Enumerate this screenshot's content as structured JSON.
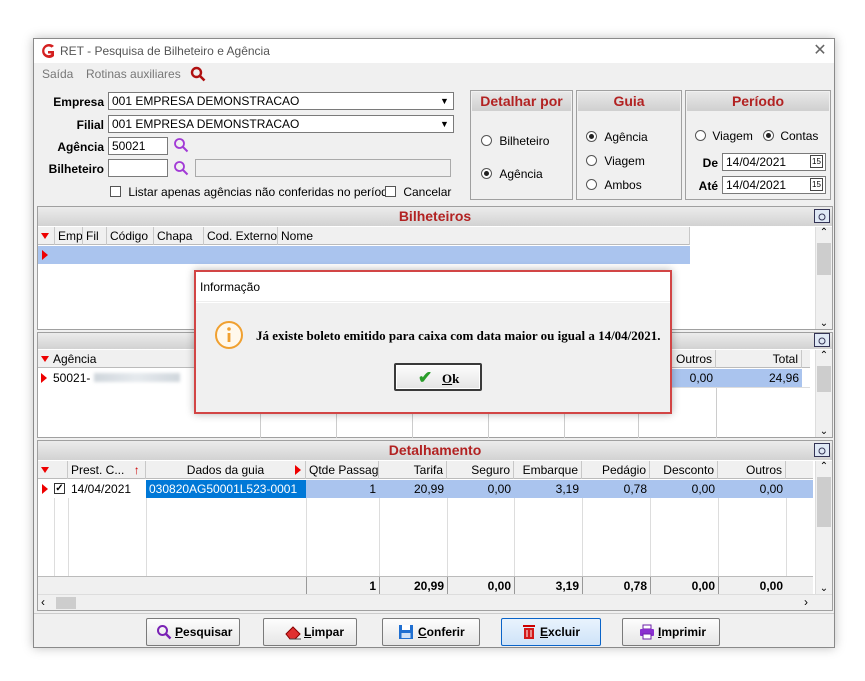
{
  "window": {
    "title": "RET - Pesquisa de Bilheteiro e Agência"
  },
  "menu": {
    "items": [
      "Saída",
      "Rotinas auxiliares"
    ]
  },
  "filters": {
    "empresa_label": "Empresa",
    "empresa_value": "001 EMPRESA DEMONSTRACAO",
    "filial_label": "Filial",
    "filial_value": "001 EMPRESA DEMONSTRACAO",
    "agencia_label": "Agência",
    "agencia_value": "50021",
    "bilheteiro_label": "Bilheteiro",
    "bilheteiro_value": "",
    "bilheteiro_name": "",
    "listar_label": "Listar apenas agências não conferidas no período",
    "cancelar_label": "Cancelar"
  },
  "detalhar": {
    "title": "Detalhar por",
    "options": [
      "Bilheteiro",
      "Agência"
    ],
    "selected": "Agência"
  },
  "guia": {
    "title": "Guia",
    "options": [
      "Agência",
      "Viagem",
      "Ambos"
    ],
    "selected": "Agência"
  },
  "periodo": {
    "title": "Período",
    "options": [
      "Viagem",
      "Contas"
    ],
    "selected": "Contas",
    "de_label": "De",
    "de_value": "14/04/2021",
    "ate_label": "Até",
    "ate_value": "14/04/2021"
  },
  "bilheteiros": {
    "title": "Bilheteiros",
    "columns": [
      "Emp",
      "Fil",
      "Código",
      "Chapa",
      "Cod. Externo",
      "Nome"
    ]
  },
  "agencias": {
    "columns": [
      "Agência",
      "Outros",
      "Total"
    ],
    "row": {
      "agencia": "50021-",
      "outros": "0,00",
      "total": "24,96"
    }
  },
  "detalhamento": {
    "title": "Detalhamento",
    "columns": [
      "Prest. C...",
      "Dados da guia",
      "Qtde Passag",
      "Tarifa",
      "Seguro",
      "Embarque",
      "Pedágio",
      "Desconto",
      "Outros"
    ],
    "row": {
      "prest": "14/04/2021",
      "guia": "030820AG50001L523-0001",
      "qtde": "1",
      "tarifa": "20,99",
      "seguro": "0,00",
      "embarque": "3,19",
      "pedagio": "0,78",
      "desconto": "0,00",
      "outros": "0,00"
    },
    "totals": {
      "qtde": "1",
      "tarifa": "20,99",
      "seguro": "0,00",
      "embarque": "3,19",
      "pedagio": "0,78",
      "desconto": "0,00",
      "outros": "0,00"
    }
  },
  "buttons": {
    "pesquisar": {
      "hot": "P",
      "rest": "esquisar"
    },
    "limpar": {
      "hot": "L",
      "rest": "impar"
    },
    "conferir": {
      "hot": "C",
      "rest": "onferir"
    },
    "excluir": {
      "hot": "E",
      "rest": "xcluir"
    },
    "imprimir": {
      "hot": "I",
      "rest": "mprimir"
    }
  },
  "dialog": {
    "title": "Informação",
    "message": "Já existe boleto emitido para caixa com data maior ou igual a 14/04/2021.",
    "ok_hot": "O",
    "ok_rest": "k"
  },
  "colors": {
    "accent_red": "#b22222",
    "selection_blue": "#aac4ee",
    "guia_cell_blue": "#0078d7",
    "dialog_border": "#d24545"
  }
}
